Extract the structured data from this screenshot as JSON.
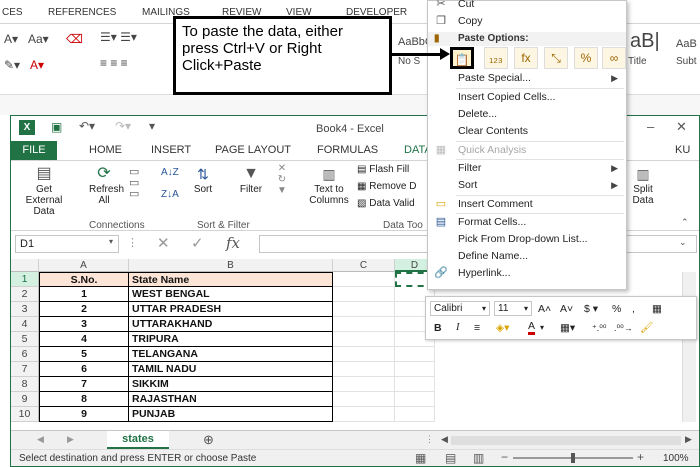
{
  "background_window": {
    "tabs": [
      "CES",
      "REFERENCES",
      "MAILINGS",
      "REVIEW",
      "VIEW",
      "DEVELOPER"
    ],
    "style_samples": [
      "AaBbC",
      "aB|",
      "AaB"
    ],
    "style_labels": [
      "tle",
      "No S",
      "Title",
      "Subt"
    ]
  },
  "window": {
    "title": "Book4 - Excel",
    "tabs": [
      "FILE",
      "HOME",
      "INSERT",
      "PAGE LAYOUT",
      "FORMULAS",
      "DATA",
      "KU"
    ],
    "name_box": "D1",
    "fx_label": "fx"
  },
  "ribbon": {
    "get_external_data": "Get External Data",
    "refresh_all": "Refresh All",
    "connections_group": "Connections",
    "sort": "Sort",
    "filter": "Filter",
    "sort_filter_group": "Sort & Filter",
    "text_to_columns": "Text to Columns",
    "flash_fill": "Flash Fill",
    "remove_duplicates": "Remove D",
    "data_validation": "Data Valid",
    "data_tools_group": "Data Too",
    "split_data": "Split Data"
  },
  "grid": {
    "columns": [
      "A",
      "B",
      "C",
      "D"
    ],
    "rows": [
      {
        "n": "1",
        "a": "S.No.",
        "b": "State Name"
      },
      {
        "n": "2",
        "a": "1",
        "b": "WEST BENGAL"
      },
      {
        "n": "3",
        "a": "2",
        "b": "UTTAR PRADESH"
      },
      {
        "n": "4",
        "a": "3",
        "b": "UTTARAKHAND"
      },
      {
        "n": "5",
        "a": "4",
        "b": "TRIPURA"
      },
      {
        "n": "6",
        "a": "5",
        "b": "TELANGANA"
      },
      {
        "n": "7",
        "a": "6",
        "b": "TAMIL NADU"
      },
      {
        "n": "8",
        "a": "7",
        "b": "SIKKIM"
      },
      {
        "n": "9",
        "a": "8",
        "b": "RAJASTHAN"
      },
      {
        "n": "10",
        "a": "9",
        "b": "PUNJAB"
      }
    ]
  },
  "sheet_tab": "states",
  "status_text": "Select destination and press ENTER or choose Paste",
  "zoom": "100%",
  "callout": "To paste the data, either press Ctrl+V or Right Click+Paste",
  "context_menu": {
    "cut": "Cut",
    "copy": "Copy",
    "paste_options": "Paste Options:",
    "paste_special": "Paste Special...",
    "insert_copied_cells": "Insert Copied Cells...",
    "delete": "Delete...",
    "clear_contents": "Clear Contents",
    "quick_analysis": "Quick Analysis",
    "filter": "Filter",
    "sort": "Sort",
    "insert_comment": "Insert Comment",
    "format_cells": "Format Cells...",
    "pick_from_dropdown": "Pick From Drop-down List...",
    "define_name": "Define Name...",
    "hyperlink": "Hyperlink..."
  },
  "mini_toolbar": {
    "font": "Calibri",
    "size": "11"
  },
  "colors": {
    "excel_green": "#217346",
    "header_fill": "#fce4d6",
    "paste_highlight": "#fff2cc"
  }
}
